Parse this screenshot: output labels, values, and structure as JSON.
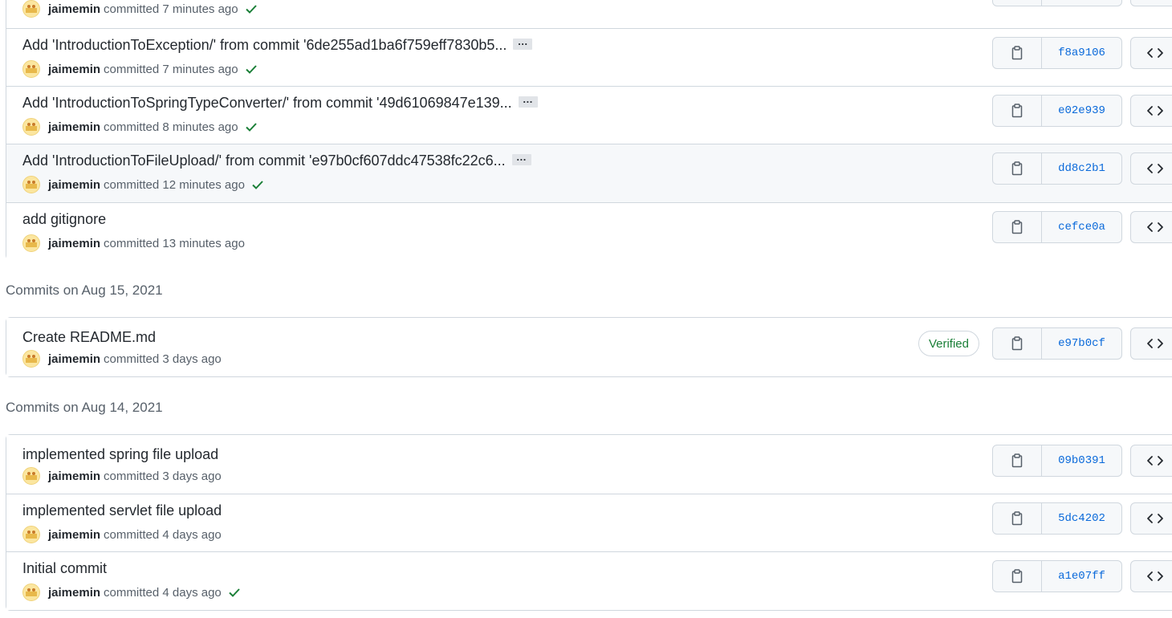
{
  "groups": [
    {
      "date_label": "",
      "commits": [
        {
          "title": "",
          "author": "jaimemin",
          "time": "committed 7 minutes ago",
          "checked": true,
          "truncated": false,
          "verified": false,
          "sha": ""
        },
        {
          "title": "Add 'IntroductionToException/' from commit '6de255ad1ba6f759eff7830b5...",
          "author": "jaimemin",
          "time": "committed 7 minutes ago",
          "checked": true,
          "truncated": true,
          "verified": false,
          "sha": "f8a9106"
        },
        {
          "title": "Add 'IntroductionToSpringTypeConverter/' from commit '49d61069847e139...",
          "author": "jaimemin",
          "time": "committed 8 minutes ago",
          "checked": true,
          "truncated": true,
          "verified": false,
          "sha": "e02e939"
        },
        {
          "title": "Add 'IntroductionToFileUpload/' from commit 'e97b0cf607ddc47538fc22c6...",
          "author": "jaimemin",
          "time": "committed 12 minutes ago",
          "checked": true,
          "truncated": true,
          "verified": false,
          "sha": "dd8c2b1"
        },
        {
          "title": "add gitignore",
          "author": "jaimemin",
          "time": "committed 13 minutes ago",
          "checked": false,
          "truncated": false,
          "verified": false,
          "sha": "cefce0a"
        }
      ]
    },
    {
      "date_label": "Commits on Aug 15, 2021",
      "commits": [
        {
          "title": "Create README.md",
          "author": "jaimemin",
          "time": "committed 3 days ago",
          "checked": false,
          "truncated": false,
          "verified": true,
          "sha": "e97b0cf"
        }
      ]
    },
    {
      "date_label": "Commits on Aug 14, 2021",
      "commits": [
        {
          "title": "implemented spring file upload",
          "author": "jaimemin",
          "time": "committed 3 days ago",
          "checked": false,
          "truncated": false,
          "verified": false,
          "sha": "09b0391"
        },
        {
          "title": "implemented servlet file upload",
          "author": "jaimemin",
          "time": "committed 4 days ago",
          "checked": false,
          "truncated": false,
          "verified": false,
          "sha": "5dc4202"
        },
        {
          "title": "Initial commit",
          "author": "jaimemin",
          "time": "committed 4 days ago",
          "checked": true,
          "truncated": false,
          "verified": false,
          "sha": "a1e07ff"
        }
      ]
    }
  ],
  "labels": {
    "ellipsis": "…",
    "verified": "Verified"
  },
  "icons": {
    "copy": "clipboard-icon",
    "browse": "code-icon",
    "check": "check-icon",
    "avatar": "avatar-image"
  },
  "colors": {
    "sha_link": "#0969da",
    "check": "#1a7f37",
    "verified": "#1a7f37",
    "border": "#d0d7de",
    "hover_row": "#f6f8fa"
  }
}
